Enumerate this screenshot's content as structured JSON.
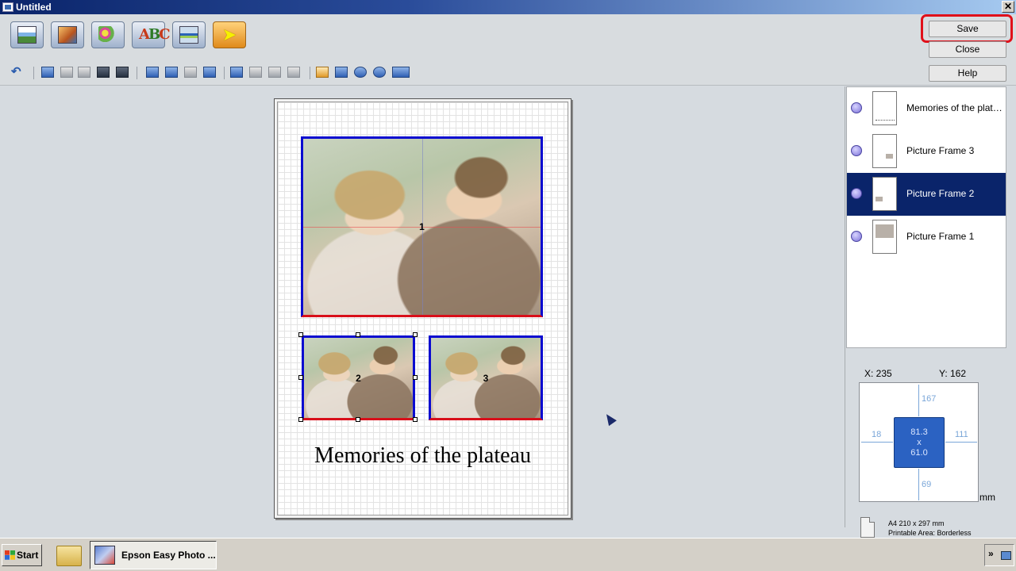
{
  "window": {
    "title": "Untitled",
    "close_glyph": "✕"
  },
  "toolbar": {
    "big_buttons": [
      {
        "name": "layout-icon"
      },
      {
        "name": "photo-icon"
      },
      {
        "name": "decoration-icon"
      },
      {
        "name": "text-icon",
        "text_a": "A",
        "text_b": "B",
        "text_c": "C"
      },
      {
        "name": "lines-icon"
      },
      {
        "name": "select-tool-icon",
        "glyph": "➤"
      }
    ],
    "undo_glyph": "↶"
  },
  "actions": {
    "save_label": "Save",
    "close_label": "Close",
    "help_label": "Help",
    "highlight_color": "#e0101a"
  },
  "canvas": {
    "frame_1_number": "1",
    "frame_2_number": "2",
    "frame_3_number": "3",
    "caption": "Memories of the plateau",
    "frame_border_color": "#0b0bd0",
    "frame_bottom_color": "#d80f1a"
  },
  "layers": [
    {
      "label": "Memories of the plateau",
      "selected": false
    },
    {
      "label": "Picture Frame 3",
      "selected": false
    },
    {
      "label": "Picture Frame 2",
      "selected": true
    },
    {
      "label": "Picture Frame 1",
      "selected": false
    }
  ],
  "position": {
    "x_label": "X: 235",
    "y_label": "Y: 162",
    "top": "167",
    "left": "18",
    "right": "111",
    "bottom": "69",
    "width": "81.3",
    "times": "x",
    "height": "61.0",
    "unit": "mm"
  },
  "paper": {
    "line1": "A4 210 x 297 mm",
    "line2": "Printable Area: Borderless"
  },
  "taskbar": {
    "start_label": "Start",
    "task_label": "Epson Easy Photo ...",
    "tray_chevron": "»"
  }
}
